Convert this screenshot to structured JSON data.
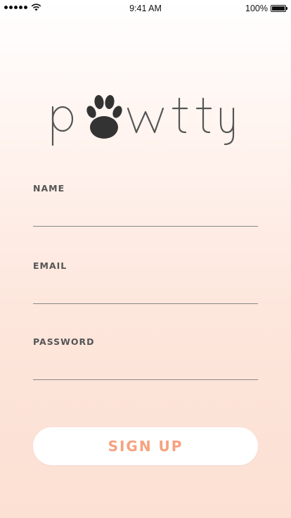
{
  "status_bar": {
    "time": "9:41 AM",
    "battery_percent": "100%",
    "signal_icon": "signal-dots-icon",
    "wifi_icon": "wifi-icon",
    "battery_icon": "battery-icon"
  },
  "logo": {
    "text": "pawtty",
    "icon": "paw-print-icon",
    "text_color": "#555555",
    "paw_color": "#333333"
  },
  "form": {
    "name_label": "NAME",
    "email_label": "EMAIL",
    "password_label": "PASSWORD",
    "name_value": "",
    "email_value": "",
    "password_value": ""
  },
  "actions": {
    "signup_label": "SIGN UP"
  },
  "colors": {
    "accent": "#f6a27f",
    "background_top": "#ffffff",
    "background_bottom": "#fce0d3",
    "button_bg": "#ffffff"
  }
}
